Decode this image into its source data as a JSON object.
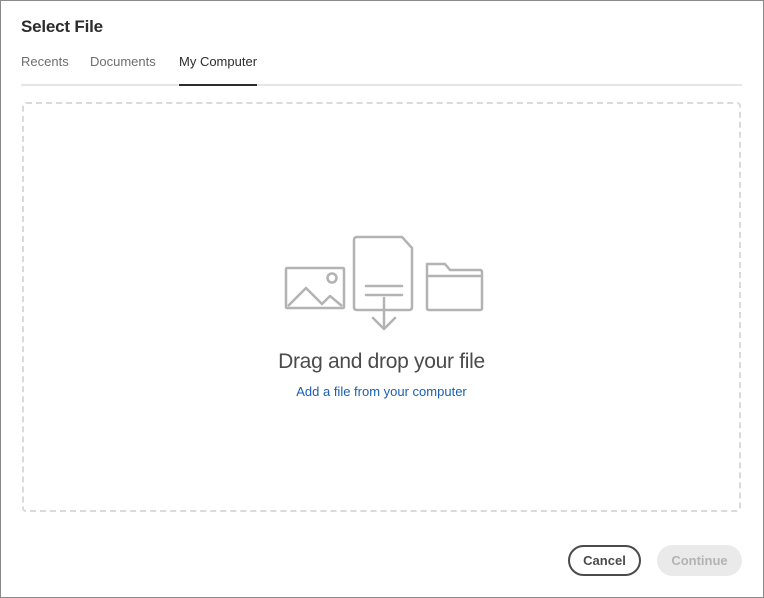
{
  "dialog": {
    "title": "Select File"
  },
  "tabs": [
    {
      "label": "Recents",
      "active": false
    },
    {
      "label": "Documents",
      "active": false
    },
    {
      "label": "My Computer",
      "active": true
    }
  ],
  "dropzone": {
    "heading": "Drag and drop your file",
    "link": "Add a file from your computer",
    "icons": [
      "image-icon",
      "document-download-icon",
      "folder-icon"
    ]
  },
  "footer": {
    "cancel_label": "Cancel",
    "continue_label": "Continue"
  },
  "colors": {
    "link": "#1a5fb4",
    "icon_stroke": "#b3b3b3",
    "dashed_border": "#dadada",
    "disabled_button_bg": "#eaeaea"
  }
}
